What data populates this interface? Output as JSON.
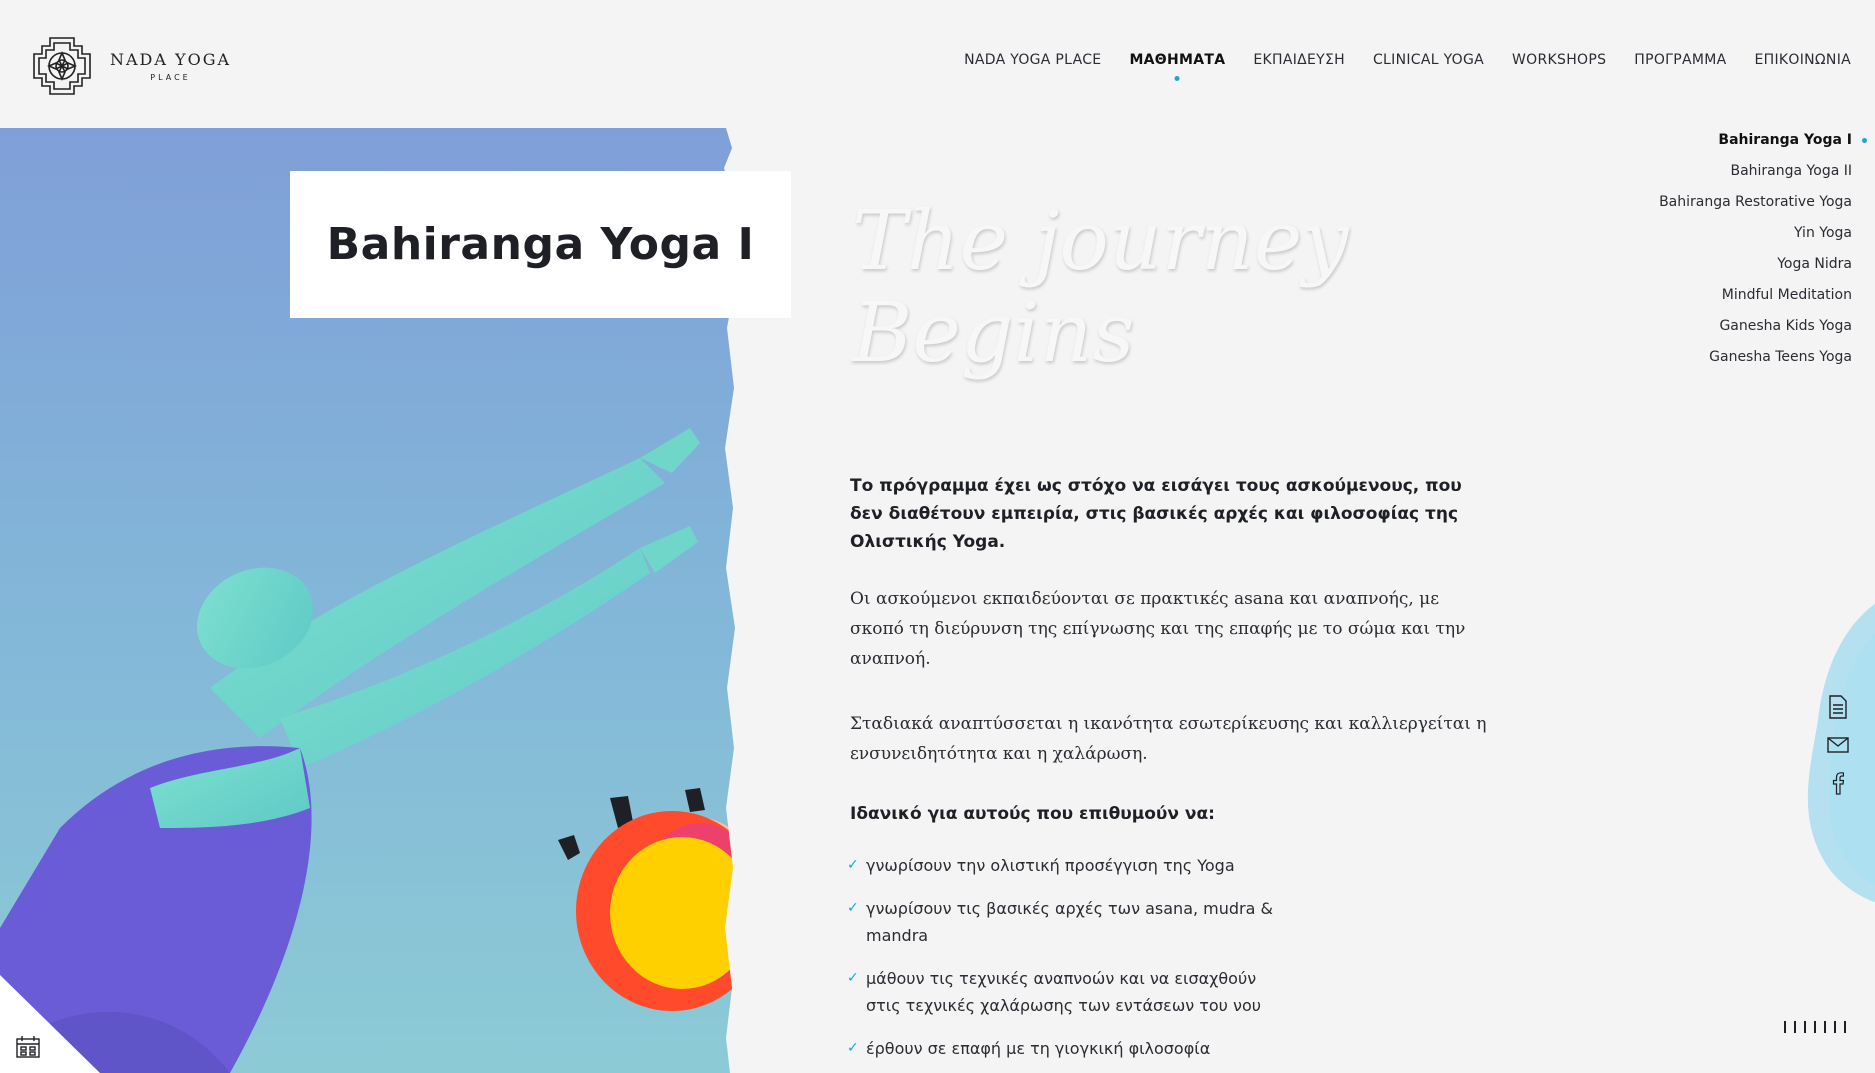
{
  "header": {
    "logo_main": "NADA YOGA",
    "logo_sub": "PLACE",
    "nav": [
      {
        "label": "NADA YOGA PLACE",
        "active": false
      },
      {
        "label": "ΜΑΘΗΜΑΤΑ",
        "active": true
      },
      {
        "label": "ΕΚΠΑΙΔΕΥΣΗ",
        "active": false
      },
      {
        "label": "CLINICAL YOGA",
        "active": false
      },
      {
        "label": "WORKSHOPS",
        "active": false
      },
      {
        "label": "ΠΡΟΓΡΑΜΜΑ",
        "active": false
      },
      {
        "label": "ΕΠΙΚΟΙΝΩΝΙΑ",
        "active": false
      }
    ]
  },
  "hero": {
    "title": "Bahiranga Yoga I",
    "tagline": "The journey Begins"
  },
  "submenu": [
    {
      "label": "Bahiranga Yoga I",
      "active": true
    },
    {
      "label": "Bahiranga Yoga II",
      "active": false
    },
    {
      "label": "Bahiranga Restorative Yoga",
      "active": false
    },
    {
      "label": "Yin Yoga",
      "active": false
    },
    {
      "label": "Yoga Nidra",
      "active": false
    },
    {
      "label": "Mindful Meditation",
      "active": false
    },
    {
      "label": "Ganesha Kids Yoga",
      "active": false
    },
    {
      "label": "Ganesha Teens Yoga",
      "active": false
    }
  ],
  "content": {
    "lead": "Το πρόγραμμα έχει ως στόχο να εισάγει τους ασκούμενους, που δεν διαθέτουν εμπειρία, στις βασικές αρχές και φιλοσοφίας της Ολιστικής Yoga.",
    "para1": "Οι ασκούμενοι εκπαιδεύονται σε πρακτικές asana και αναπνοής, με σκοπό τη διεύρυνση της επίγνωσης και της επαφής με το σώμα και την αναπνοή.",
    "para2": "Σταδιακά αναπτύσσεται η ικανότητα εσωτερίκευσης και καλλιεργείται η ενσυνειδητότητα και η χαλάρωση.",
    "ideal_heading": "Ιδανικό για αυτούς που επιθυμούν να:",
    "bullets": [
      "γνωρίσουν την ολιστική προσέγγιση της Yoga",
      "γνωρίσουν τις βασικές αρχές των asana, mudra & mandra",
      "μάθουν τις τεχνικές αναπνοών και να εισαχθούν στις τεχνικές χαλάρωσης των εντάσεων του νου",
      "έρθουν σε επαφή με τη γιογκική φιλοσοφία"
    ]
  },
  "icons": {
    "document": "document-icon",
    "mail": "mail-icon",
    "facebook": "facebook-icon",
    "calendar": "calendar-icon",
    "check": "check-icon"
  },
  "colors": {
    "accent": "#1aa6d6",
    "background": "#f3f4f3",
    "text": "#1f2026"
  }
}
